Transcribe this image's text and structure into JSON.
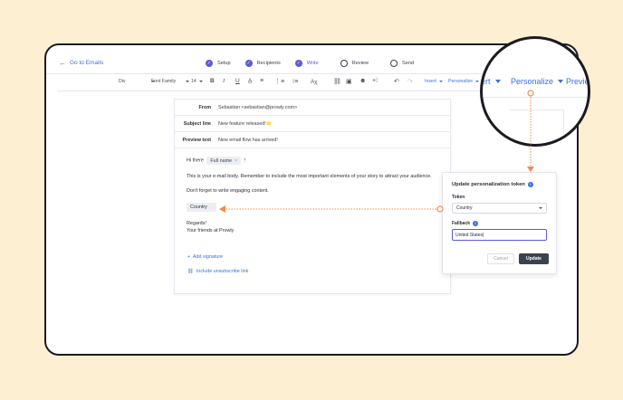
{
  "nav": {
    "back_label": "Go to Emails",
    "steps": [
      {
        "label": "Setup",
        "state": "done"
      },
      {
        "label": "Recipients",
        "state": "done"
      },
      {
        "label": "Write",
        "state": "active"
      },
      {
        "label": "Review",
        "state": "todo"
      },
      {
        "label": "Send",
        "state": "todo"
      }
    ]
  },
  "toolbar": {
    "block_type": "Div",
    "font_family": "Font Family",
    "font_size": "14",
    "insert_label": "Insert",
    "personalize_label": "Personalize"
  },
  "email": {
    "from_label": "From",
    "from_value": "Sebastian <sebastian@prowly.com>",
    "subject_label": "Subject line",
    "subject_value": "New feature released!⭐",
    "preview_label": "Preview text",
    "preview_value": "New email flow has arrived!",
    "greeting_prefix": "Hi there",
    "greeting_token": "Full name",
    "greeting_suffix": "!",
    "paragraph1": "This is your e-mail body. Remember to include the most important elements of your story to attract your audience.",
    "paragraph2": "Don't forget to write engaging content.",
    "country_token": "Country",
    "regards": "Regards!",
    "signoff": "Your friends at Prowly",
    "add_signature": "Add signature",
    "unsubscribe": "Include unsubscribe link"
  },
  "panel": {
    "title": "Update personalization token",
    "token_label": "Token",
    "token_value": "Country",
    "fallback_label": "Fallback",
    "fallback_value": "United States|",
    "cancel_label": "Cancel",
    "update_label": "Update"
  },
  "magnifier": {
    "left_fragment": "ert",
    "personalize_label": "Personalize",
    "right_fragment": "Previe"
  },
  "colors": {
    "accent": "#5b5bd6",
    "link": "#3b6fe0",
    "callout": "#f08a4b",
    "background": "#fdf0d2"
  }
}
